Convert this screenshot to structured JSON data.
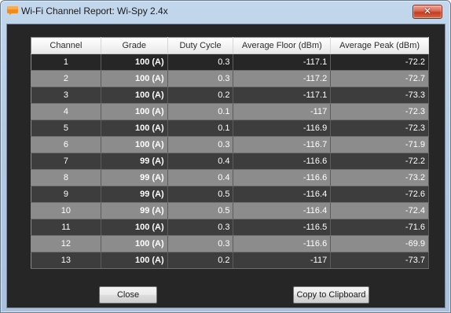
{
  "window": {
    "title": "Wi-Fi Channel Report: Wi-Spy 2.4x",
    "close_glyph": "✕",
    "icon": "app-icon"
  },
  "table": {
    "columns": [
      "Channel",
      "Grade",
      "Duty Cycle",
      "Average Floor (dBm)",
      "Average Peak (dBm)"
    ],
    "rows": [
      {
        "channel": "1",
        "grade": "100 (A)",
        "duty": "0.3",
        "floor": "-117.1",
        "peak": "-72.2"
      },
      {
        "channel": "2",
        "grade": "100 (A)",
        "duty": "0.3",
        "floor": "-117.2",
        "peak": "-72.7"
      },
      {
        "channel": "3",
        "grade": "100 (A)",
        "duty": "0.2",
        "floor": "-117.1",
        "peak": "-73.3"
      },
      {
        "channel": "4",
        "grade": "100 (A)",
        "duty": "0.1",
        "floor": "-117",
        "peak": "-72.3"
      },
      {
        "channel": "5",
        "grade": "100 (A)",
        "duty": "0.1",
        "floor": "-116.9",
        "peak": "-72.3"
      },
      {
        "channel": "6",
        "grade": "100 (A)",
        "duty": "0.3",
        "floor": "-116.7",
        "peak": "-71.9"
      },
      {
        "channel": "7",
        "grade": "99 (A)",
        "duty": "0.4",
        "floor": "-116.6",
        "peak": "-72.2"
      },
      {
        "channel": "8",
        "grade": "99 (A)",
        "duty": "0.4",
        "floor": "-116.6",
        "peak": "-73.2"
      },
      {
        "channel": "9",
        "grade": "99 (A)",
        "duty": "0.5",
        "floor": "-116.4",
        "peak": "-72.6"
      },
      {
        "channel": "10",
        "grade": "99 (A)",
        "duty": "0.5",
        "floor": "-116.4",
        "peak": "-72.4"
      },
      {
        "channel": "11",
        "grade": "100 (A)",
        "duty": "0.3",
        "floor": "-116.5",
        "peak": "-71.6"
      },
      {
        "channel": "12",
        "grade": "100 (A)",
        "duty": "0.3",
        "floor": "-116.6",
        "peak": "-69.9"
      },
      {
        "channel": "13",
        "grade": "100 (A)",
        "duty": "0.2",
        "floor": "-117",
        "peak": "-73.7"
      }
    ]
  },
  "buttons": {
    "close_label": "Close",
    "copy_label": "Copy to Clipboard"
  },
  "colors": {
    "titlebar": "#b4cbe4",
    "client_background": "#262626",
    "row_dark": "#3d3d3d",
    "row_light": "#8c8c8c",
    "row_selected": "#262626",
    "close_button": "#c43c22"
  }
}
